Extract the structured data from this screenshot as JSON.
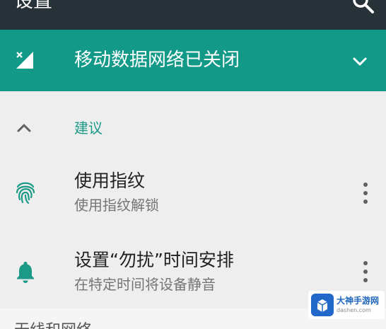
{
  "header": {
    "title": "设置",
    "search_icon": "search-icon",
    "background": "#263238"
  },
  "mobile_data_banner": {
    "icon": "mobile-data-off-icon",
    "text": "移动数据网络已关闭",
    "expand_icon": "chevron-down-icon",
    "background": "#129988"
  },
  "suggestions": {
    "header_label": "建议",
    "collapse_icon": "chevron-up-icon",
    "accent": "#1d9a87",
    "items": [
      {
        "icon": "fingerprint-icon",
        "title": "使用指纹",
        "subtitle": "使用指纹解锁",
        "menu_icon": "more-vert-icon"
      },
      {
        "icon": "bell-icon",
        "title": "设置“勿扰”时间安排",
        "subtitle": "在特定时间将设备静音",
        "menu_icon": "more-vert-icon"
      }
    ]
  },
  "next_section": {
    "title_partial": "无线和网络"
  },
  "watermark": {
    "name": "大神手游网",
    "url": "dashen.com"
  }
}
